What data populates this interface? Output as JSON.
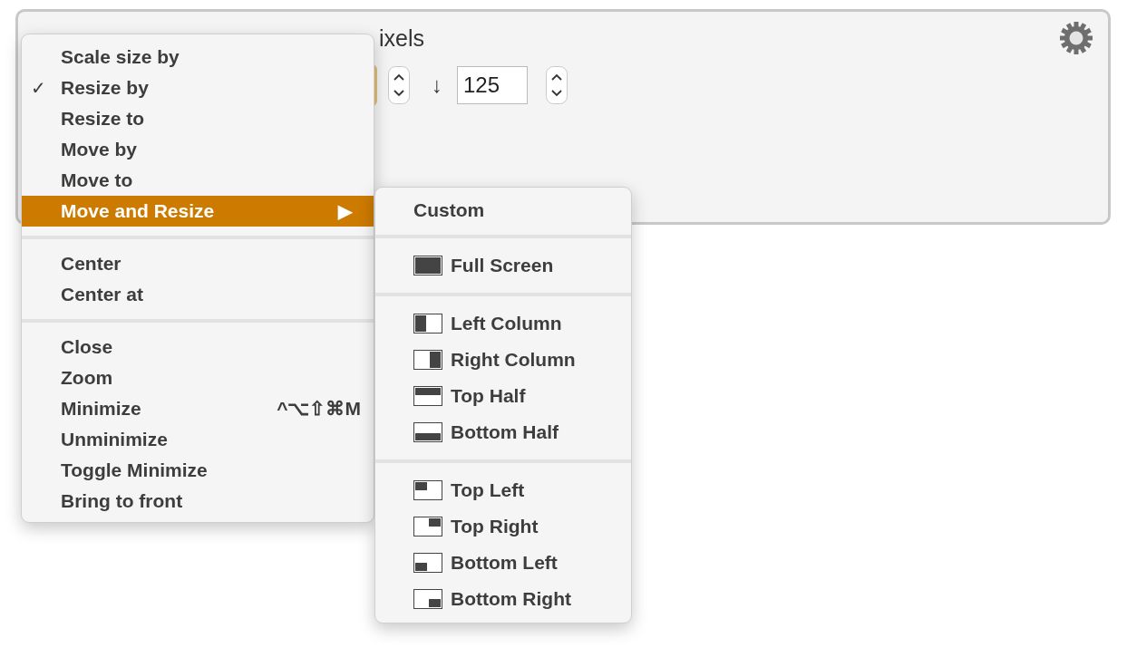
{
  "action": {
    "title_visible": "ixels",
    "height_value": "125",
    "height_arrow": "↓"
  },
  "menu": {
    "items": [
      {
        "kind": "item",
        "label": "Scale size by",
        "checked": false,
        "selected": false
      },
      {
        "kind": "item",
        "label": "Resize by",
        "checked": true,
        "selected": false
      },
      {
        "kind": "item",
        "label": "Resize to",
        "checked": false,
        "selected": false
      },
      {
        "kind": "item",
        "label": "Move by",
        "checked": false,
        "selected": false
      },
      {
        "kind": "item",
        "label": "Move to",
        "checked": false,
        "selected": false
      },
      {
        "kind": "item",
        "label": "Move and Resize",
        "checked": false,
        "selected": true,
        "submenu_arrow": "▶"
      },
      {
        "kind": "separator"
      },
      {
        "kind": "item",
        "label": "Center",
        "checked": false,
        "selected": false
      },
      {
        "kind": "item",
        "label": "Center at",
        "checked": false,
        "selected": false
      },
      {
        "kind": "separator"
      },
      {
        "kind": "item",
        "label": "Close",
        "checked": false,
        "selected": false
      },
      {
        "kind": "item",
        "label": "Zoom",
        "checked": false,
        "selected": false
      },
      {
        "kind": "item",
        "label": "Minimize",
        "checked": false,
        "selected": false,
        "shortcut": "^⌥⇧⌘M"
      },
      {
        "kind": "item",
        "label": "Unminimize",
        "checked": false,
        "selected": false
      },
      {
        "kind": "item",
        "label": "Toggle Minimize",
        "checked": false,
        "selected": false
      },
      {
        "kind": "item",
        "label": "Bring to front",
        "checked": false,
        "selected": false
      }
    ]
  },
  "check_mark": "✓",
  "submenu": {
    "items": [
      {
        "kind": "plain",
        "label": "Custom"
      },
      {
        "kind": "separator"
      },
      {
        "kind": "full",
        "label": "Full Screen"
      },
      {
        "kind": "separator"
      },
      {
        "kind": "left",
        "label": "Left Column"
      },
      {
        "kind": "right",
        "label": "Right Column"
      },
      {
        "kind": "top",
        "label": "Top Half"
      },
      {
        "kind": "bottom",
        "label": "Bottom Half"
      },
      {
        "kind": "separator"
      },
      {
        "kind": "top-left",
        "label": "Top Left"
      },
      {
        "kind": "top-right",
        "label": "Top Right"
      },
      {
        "kind": "bottom-left",
        "label": "Bottom Left"
      },
      {
        "kind": "bottom-right",
        "label": "Bottom Right"
      }
    ]
  }
}
